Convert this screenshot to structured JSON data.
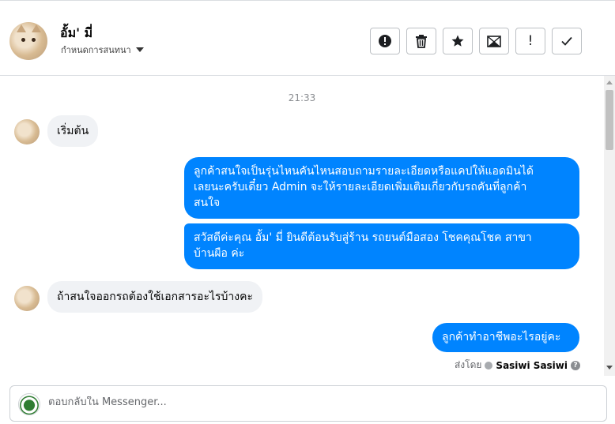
{
  "header": {
    "contact_name": "อั้ม' มี่",
    "assign_label": "กำหนดการสนทนา",
    "toolbar": [
      {
        "icon": "alert-circle-icon",
        "name": "spam-button"
      },
      {
        "icon": "trash-icon",
        "name": "delete-button"
      },
      {
        "icon": "star-icon",
        "name": "follow-up-button"
      },
      {
        "icon": "mail-icon",
        "name": "mark-unread-button"
      },
      {
        "icon": "exclamation-icon",
        "name": "important-button"
      },
      {
        "icon": "check-icon",
        "name": "mark-done-button"
      }
    ],
    "toolbar_marks": {
      "important": "!"
    }
  },
  "thread": {
    "timestamp": "21:33",
    "messages": [
      {
        "direction": "in",
        "text": "เริ่มต้น"
      },
      {
        "direction": "out",
        "lines": [
          "ลูกค้าสนใจเป็นรุ่นไหนคันไหนสอบถามรายละเอียดหรือแคปให้แอดมินได้",
          "เลยนะครับเดี๋ยว Admin จะให้รายละเอียดเพิ่มเติมเกี่ยวกับรถคันที่ลูกค้า",
          "สนใจ"
        ]
      },
      {
        "direction": "out",
        "lines": [
          "สวัสดีค่ะคุณ อั้ม' มี่ ยินดีต้อนรับสู่ร้าน รถยนต์มือสอง โชคคุณโชค สาขา",
          "บ้านผือ ค่ะ"
        ]
      },
      {
        "direction": "in",
        "text": "ถ้าสนใจออกรถต้องใช้เอกสารอะไรบ้างคะ"
      },
      {
        "direction": "out",
        "text": "ลูกค้าทำอาชีพอะไรอยู่คะ"
      }
    ],
    "sent_by_label": "ส่งโดย",
    "sent_by_name": "Sasiwi Sasiwi",
    "help_mark": "?"
  },
  "composer": {
    "placeholder": "ตอบกลับใน Messenger..."
  },
  "colors": {
    "accent": "#0084ff",
    "incoming_bubble": "#f0f2f5"
  }
}
